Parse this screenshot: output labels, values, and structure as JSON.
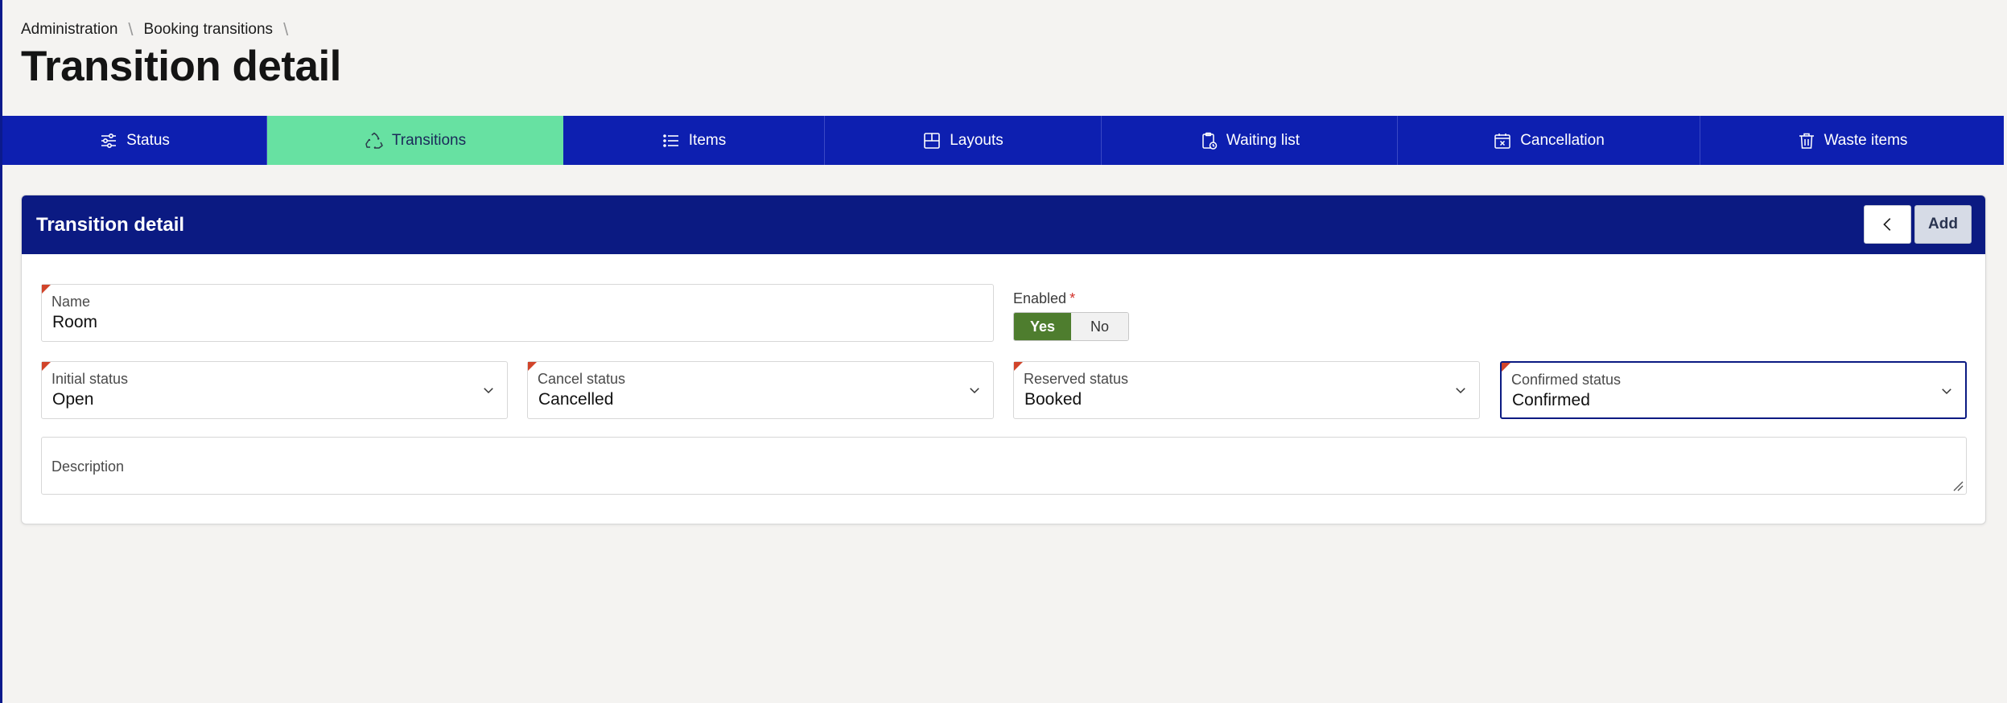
{
  "breadcrumb": [
    "Administration",
    "Booking transitions"
  ],
  "page_title": "Transition detail",
  "tabs": [
    {
      "label": "Status",
      "icon": "sliders-icon",
      "active": false
    },
    {
      "label": "Transitions",
      "icon": "recycle-icon",
      "active": true
    },
    {
      "label": "Items",
      "icon": "list-icon",
      "active": false
    },
    {
      "label": "Layouts",
      "icon": "layout-icon",
      "active": false
    },
    {
      "label": "Waiting list",
      "icon": "clipboard-clock-icon",
      "active": false
    },
    {
      "label": "Cancellation",
      "icon": "calendar-x-icon",
      "active": false
    },
    {
      "label": "Waste items",
      "icon": "trash-icon",
      "active": false
    }
  ],
  "panel": {
    "title": "Transition detail",
    "back_icon": "chevron-left-icon",
    "add_label": "Add"
  },
  "form": {
    "name": {
      "label": "Name",
      "value": "Room"
    },
    "enabled": {
      "label": "Enabled",
      "required_mark": "*",
      "yes": "Yes",
      "no": "No",
      "selected": "Yes"
    },
    "initial_status": {
      "label": "Initial status",
      "value": "Open"
    },
    "cancel_status": {
      "label": "Cancel status",
      "value": "Cancelled"
    },
    "reserved_status": {
      "label": "Reserved status",
      "value": "Booked"
    },
    "confirmed_status": {
      "label": "Confirmed status",
      "value": "Confirmed"
    },
    "description": {
      "label": "Description",
      "value": ""
    }
  },
  "colors": {
    "tabbar": "#0d1fb0",
    "active_tab": "#67e1a2",
    "panel_header": "#0b1a82",
    "toggle_on": "#4e7d2e",
    "required_marker": "#d1442a"
  }
}
